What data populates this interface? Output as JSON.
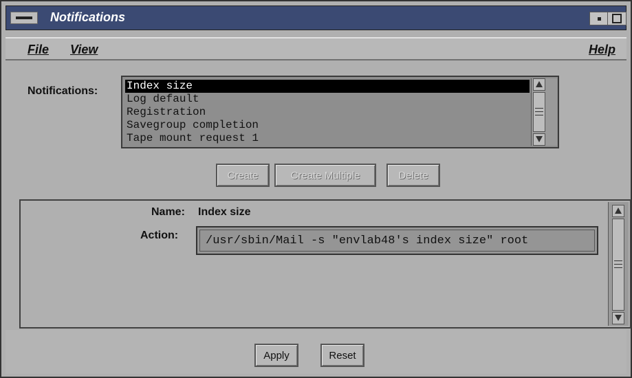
{
  "window": {
    "title": "Notifications"
  },
  "menubar": {
    "file": "File",
    "view": "View",
    "help": "Help"
  },
  "notifications": {
    "label": "Notifications:",
    "items": [
      {
        "label": "Index size",
        "selected": true
      },
      {
        "label": "Log default",
        "selected": false
      },
      {
        "label": "Registration",
        "selected": false
      },
      {
        "label": "Savegroup completion",
        "selected": false
      },
      {
        "label": "Tape mount request 1",
        "selected": false
      }
    ]
  },
  "buttons": {
    "create": "Create",
    "create_multiple": "Create Multiple",
    "delete": "Delete",
    "apply": "Apply",
    "reset": "Reset"
  },
  "detail": {
    "name_label": "Name:",
    "name_value": "Index size",
    "action_label": "Action:",
    "action_value": "/usr/sbin/Mail -s \"envlab48's index size\" root"
  },
  "colors": {
    "titlebar": "#3b4a73",
    "window_bg": "#b0b0b0",
    "list_bg": "#8e8e8e",
    "selection": "#000000"
  },
  "icons": {
    "window_menu": "window-menu-icon",
    "minimize": "minimize-icon",
    "maximize": "maximize-icon",
    "scroll_up": "scroll-up-arrow-icon",
    "scroll_down": "scroll-down-arrow-icon"
  }
}
